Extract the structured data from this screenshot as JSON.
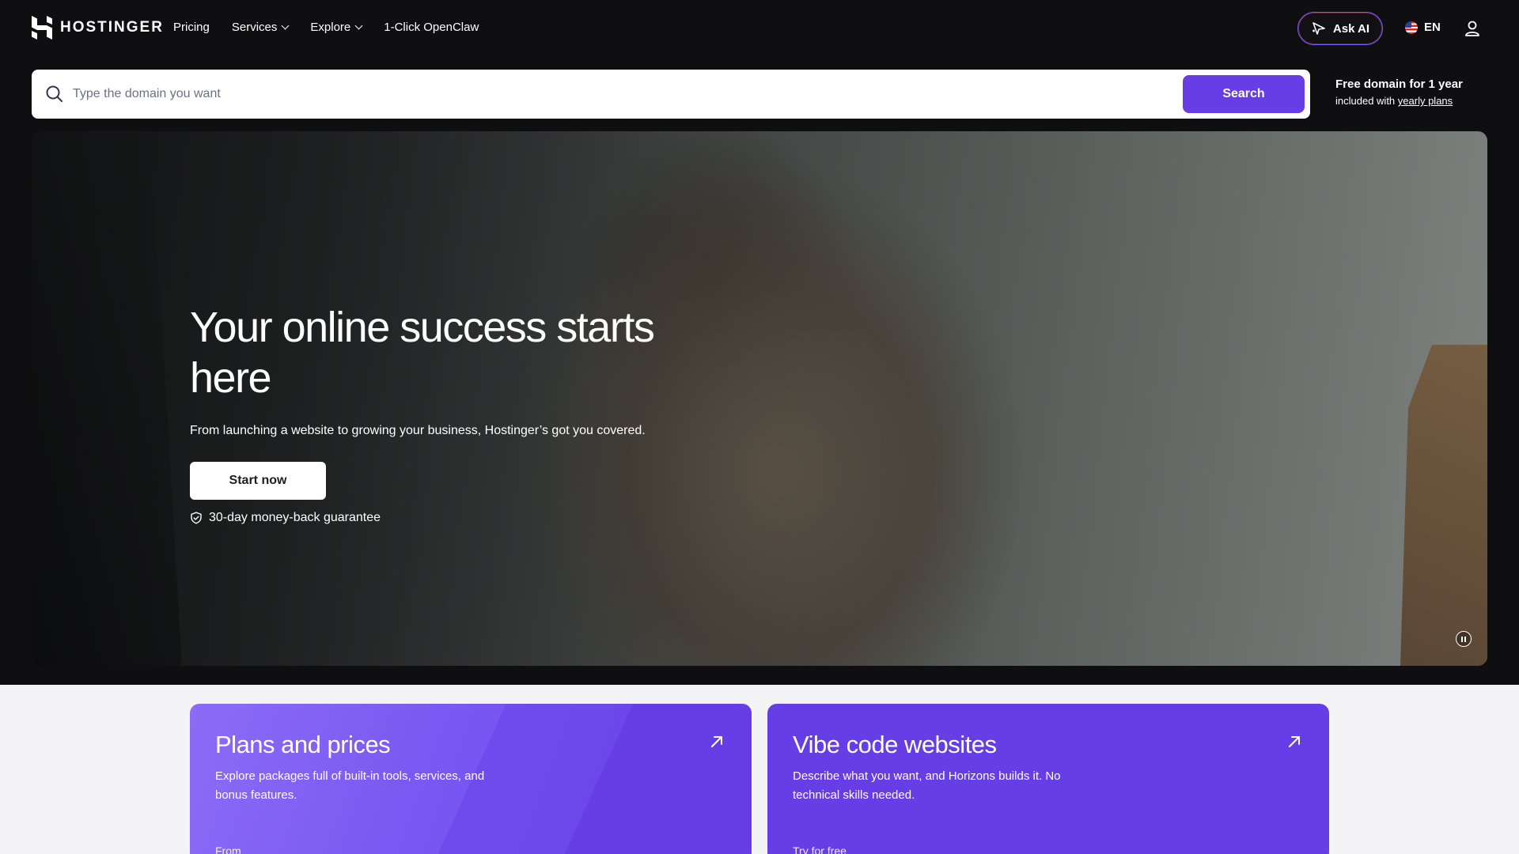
{
  "brand": {
    "name": "HOSTINGER"
  },
  "nav": {
    "links": [
      {
        "label": "Pricing"
      },
      {
        "label": "Services"
      },
      {
        "label": "Explore"
      },
      {
        "label": "1-Click OpenClaw"
      }
    ],
    "ask_ai_label": "Ask AI",
    "language": "EN"
  },
  "search": {
    "placeholder": "Type the domain you want",
    "value": "",
    "button_label": "Search"
  },
  "promo": {
    "title": "Free domain for 1 year",
    "sub_prefix": "included with",
    "sub_link": "yearly plans"
  },
  "hero": {
    "title": "Your online success starts here",
    "subtitle": "From launching a website to growing your business, Hostinger’s got you covered.",
    "cta_label": "Start now",
    "guarantee": "30-day money-back guarantee"
  },
  "cards": [
    {
      "title": "Plans and prices",
      "description": "Explore packages full of built-in tools, services, and bonus features.",
      "footer": "From"
    },
    {
      "title": "Vibe code websites",
      "description": "Describe what you want, and Horizons builds it. No technical skills needed.",
      "footer": "Try for free"
    }
  ],
  "colors": {
    "accent": "#673de6",
    "background": "#0f0f11",
    "lower_background": "#f4f4f6"
  },
  "icons": [
    "hostinger-logo-icon",
    "chevron-down-icon",
    "ai-sparkle-icon",
    "us-flag-icon",
    "user-icon",
    "search-icon",
    "shield-check-icon",
    "pause-icon",
    "arrow-up-right-icon"
  ]
}
